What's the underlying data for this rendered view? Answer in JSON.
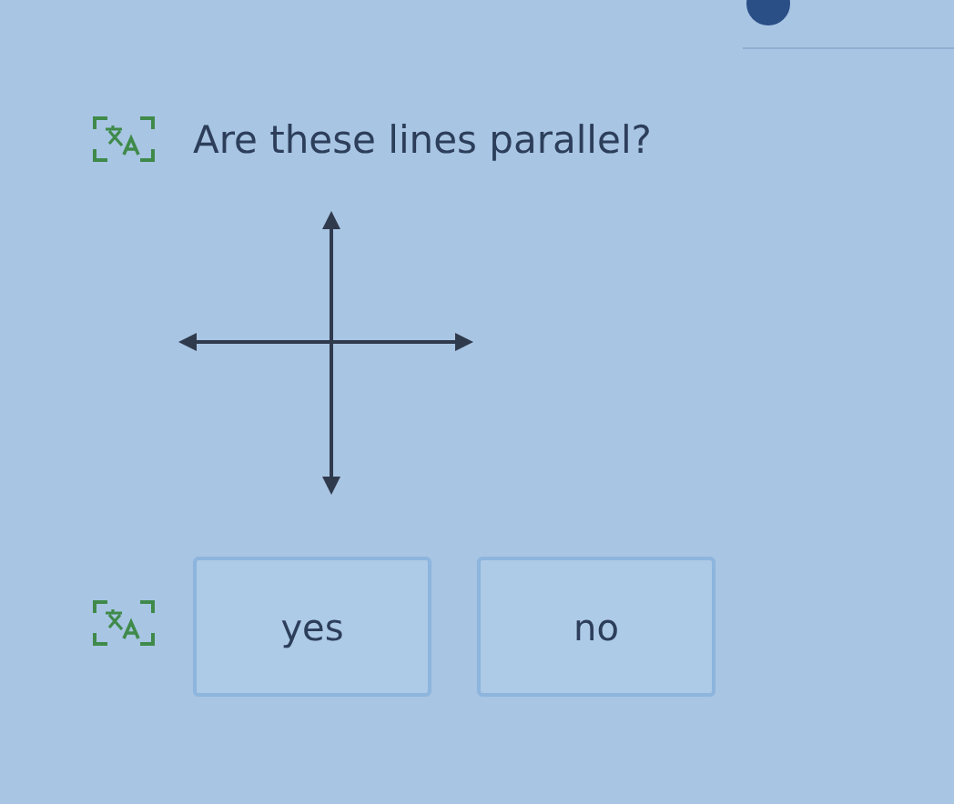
{
  "question": {
    "text": "Are these lines parallel?"
  },
  "figure": {
    "kind": "perpendicular-lines"
  },
  "choices": [
    {
      "label": "yes"
    },
    {
      "label": "no"
    }
  ]
}
